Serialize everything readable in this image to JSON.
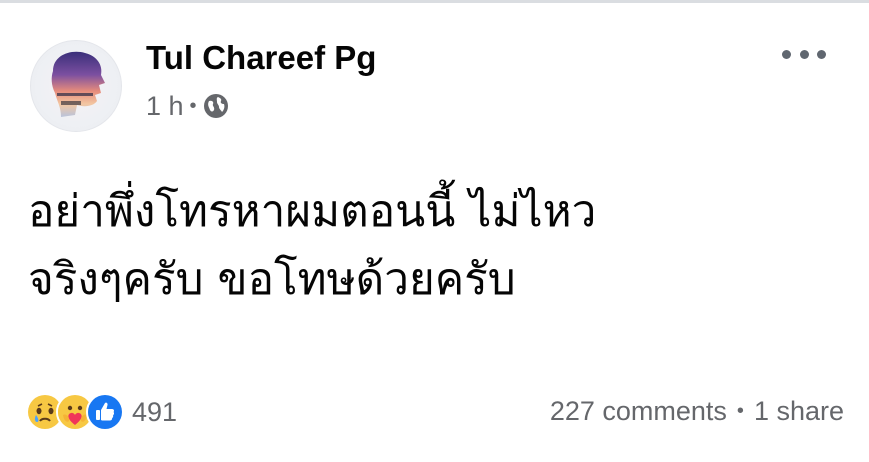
{
  "post": {
    "author": "Tul Chareef Pg",
    "time": "1 h",
    "privacy_icon": "globe-icon",
    "body_line1": "อย่าพึ่งโทรหาผมตอนนี้ ไม่ไหว",
    "body_line2": "จริงๆครับ ขอโทษด้วยครับ",
    "reaction_icons": [
      "sad-icon",
      "care-icon",
      "like-icon"
    ],
    "reaction_count": "491",
    "comments": "227 comments",
    "shares": "1 share"
  },
  "colors": {
    "text": "#050505",
    "secondary": "#65676b",
    "like_blue": "#1877f2",
    "emoji_yellow": "#f7c843"
  }
}
